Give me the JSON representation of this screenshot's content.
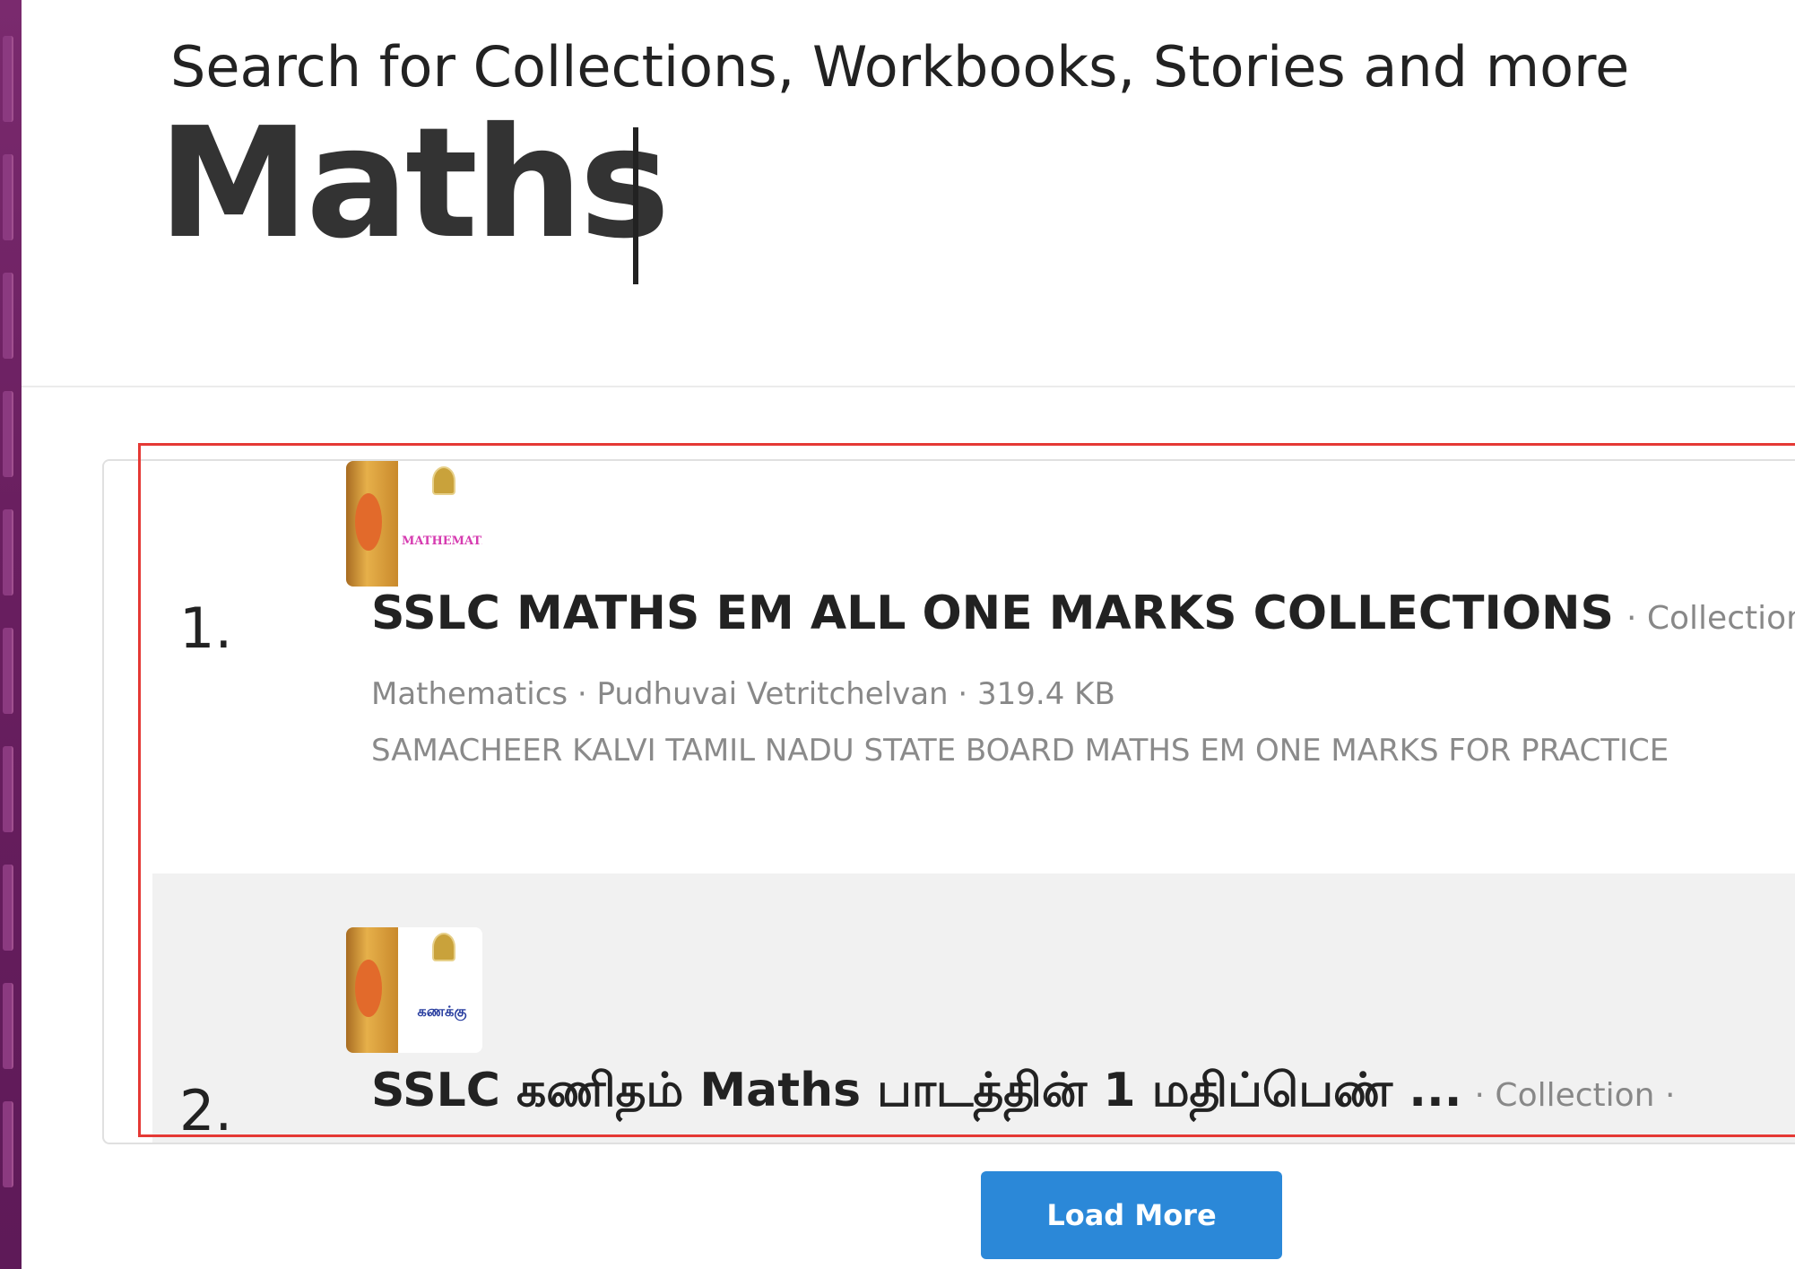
{
  "search": {
    "label": "Search for Collections, Workbooks, Stories and more",
    "query": "Maths"
  },
  "results": [
    {
      "index": "1.",
      "title": "SSLC MATHS EM ALL ONE MARKS COLLECTIONS",
      "type": "· Collection",
      "meta": "Mathematics · Pudhuvai Vetritchelvan · 319.4 KB",
      "description": "SAMACHEER KALVI TAMIL NADU STATE BOARD MATHS EM ONE MARKS FOR PRACTICE",
      "thumbnail": {
        "title": "MATHEMATICS",
        "title_color": "#d63bb0"
      }
    },
    {
      "index": "2.",
      "title": "SSLC கணிதம் Maths பாடத்தின் 1 மதிப்பெண் ...",
      "type": "· Collection ·",
      "thumbnail": {
        "title": "கணக்கு",
        "title_color": "#2a3fa0"
      }
    }
  ],
  "load_more_label": "Load More",
  "colors": {
    "accent": "#2b88d8",
    "highlight": "#e53935",
    "sidebar": "#6a1f60"
  }
}
